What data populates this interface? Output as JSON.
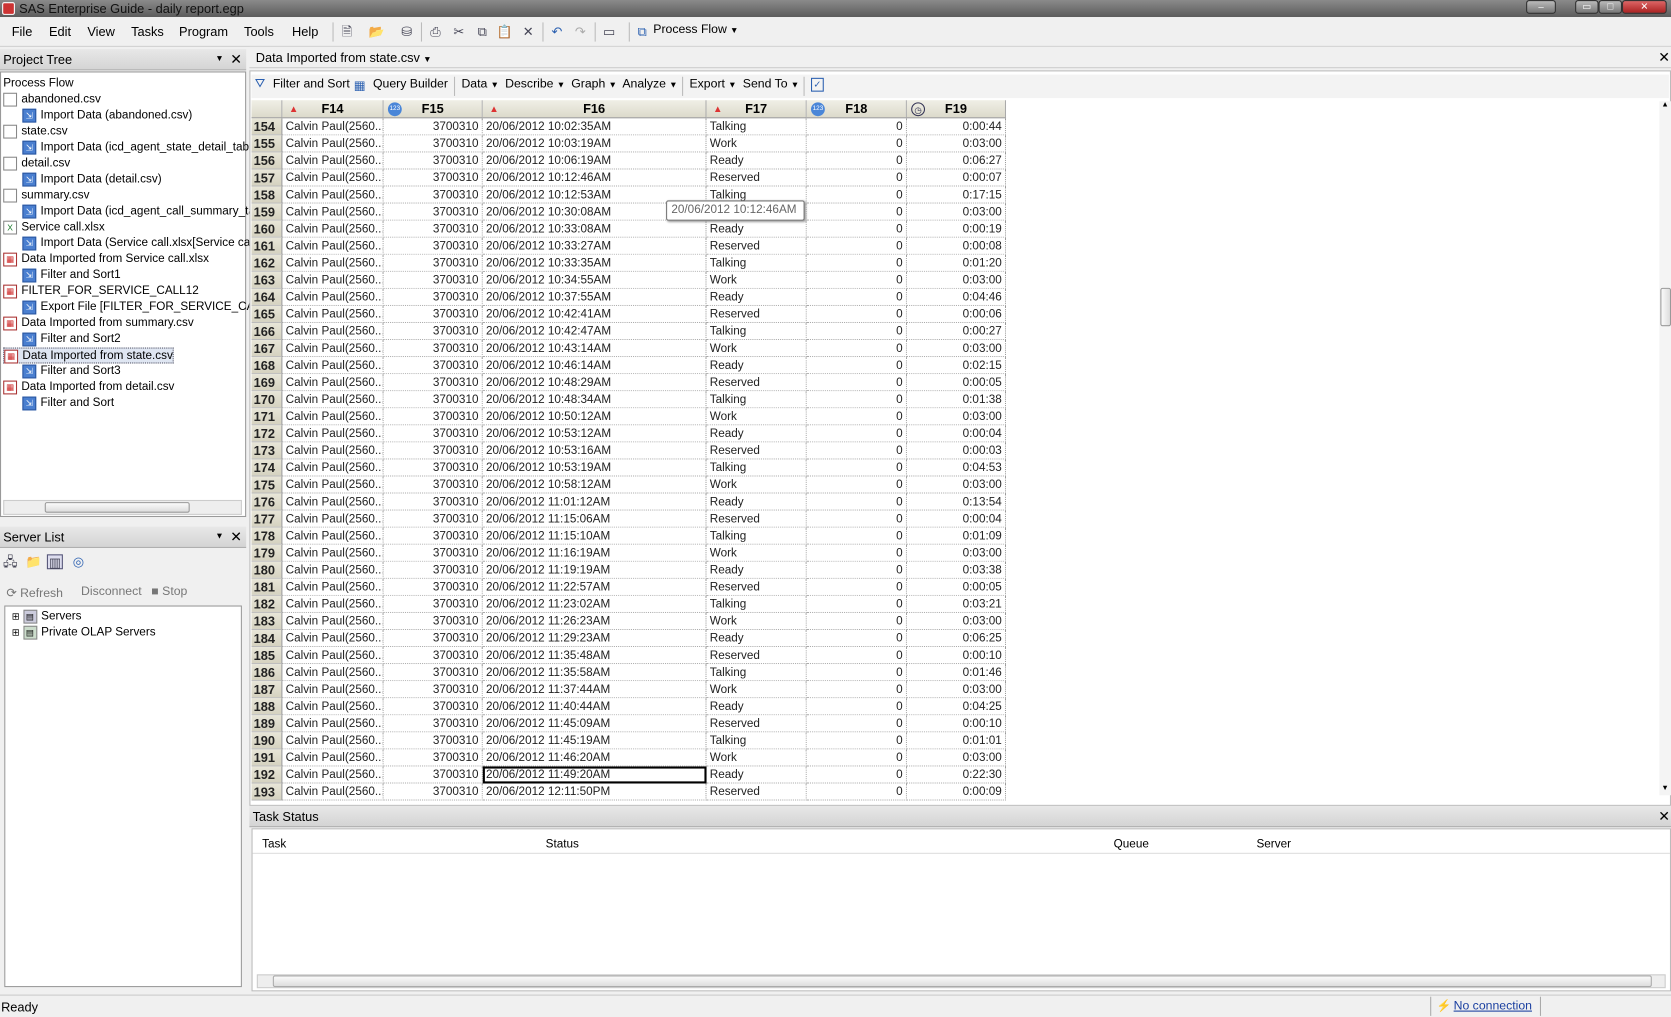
{
  "window": {
    "title": "SAS Enterprise Guide - daily report.egp"
  },
  "menu": [
    "File",
    "Edit",
    "View",
    "Tasks",
    "Program",
    "Tools",
    "Help"
  ],
  "toolbar": {
    "process_flow": "Process Flow"
  },
  "project_tree": {
    "title": "Project Tree",
    "root": "Process Flow",
    "items": [
      {
        "label": "abandoned.csv",
        "level": 0,
        "type": "file"
      },
      {
        "label": "Import Data (abandoned.csv)",
        "level": 1,
        "type": "task"
      },
      {
        "label": "state.csv",
        "level": 0,
        "type": "file"
      },
      {
        "label": "Import Data (icd_agent_state_detail_table_",
        "level": 1,
        "type": "task"
      },
      {
        "label": "detail.csv",
        "level": 0,
        "type": "file"
      },
      {
        "label": "Import Data (detail.csv)",
        "level": 1,
        "type": "task"
      },
      {
        "label": "summary.csv",
        "level": 0,
        "type": "file"
      },
      {
        "label": "Import Data (icd_agent_call_summary_table",
        "level": 1,
        "type": "task"
      },
      {
        "label": "Service call.xlsx",
        "level": 0,
        "type": "xls"
      },
      {
        "label": "Import Data (Service call.xlsx[Service call])",
        "level": 1,
        "type": "task"
      },
      {
        "label": "Data Imported from Service call.xlsx",
        "level": 0,
        "type": "data"
      },
      {
        "label": "Filter and Sort1",
        "level": 1,
        "type": "task"
      },
      {
        "label": "FILTER_FOR_SERVICE_CALL12",
        "level": 0,
        "type": "data"
      },
      {
        "label": "Export File [FILTER_FOR_SERVICE_CALL",
        "level": 1,
        "type": "task"
      },
      {
        "label": "Data Imported from summary.csv",
        "level": 0,
        "type": "data"
      },
      {
        "label": "Filter and Sort2",
        "level": 1,
        "type": "task"
      },
      {
        "label": "Data Imported from state.csv",
        "level": 0,
        "type": "data",
        "selected": true
      },
      {
        "label": "Filter and Sort3",
        "level": 1,
        "type": "task"
      },
      {
        "label": "Data Imported from detail.csv",
        "level": 0,
        "type": "data"
      },
      {
        "label": "Filter and Sort",
        "level": 1,
        "type": "task"
      }
    ]
  },
  "server_list": {
    "title": "Server List",
    "refresh": "Refresh",
    "disconnect": "Disconnect",
    "stop": "Stop",
    "items": [
      "Servers",
      "Private OLAP Servers"
    ]
  },
  "data_tab": {
    "title": "Data Imported from state.csv",
    "toolbar": {
      "filter_sort": "Filter and Sort",
      "query_builder": "Query Builder",
      "data": "Data",
      "describe": "Describe",
      "graph": "Graph",
      "analyze": "Analyze",
      "export": "Export",
      "send_to": "Send To"
    },
    "columns": [
      {
        "name": "F14",
        "type": "char"
      },
      {
        "name": "F15",
        "type": "num"
      },
      {
        "name": "F16",
        "type": "char"
      },
      {
        "name": "F17",
        "type": "char"
      },
      {
        "name": "F18",
        "type": "num"
      },
      {
        "name": "F19",
        "type": "time"
      }
    ],
    "tooltip": "20/06/2012  10:12:46AM",
    "selected_row": "192",
    "rows": [
      [
        "154",
        "Calvin Paul(2560...",
        "3700310",
        "20/06/2012  10:02:35AM",
        "Talking",
        "0",
        "0:00:44"
      ],
      [
        "155",
        "Calvin Paul(2560...",
        "3700310",
        "20/06/2012  10:03:19AM",
        "Work",
        "0",
        "0:03:00"
      ],
      [
        "156",
        "Calvin Paul(2560...",
        "3700310",
        "20/06/2012  10:06:19AM",
        "Ready",
        "0",
        "0:06:27"
      ],
      [
        "157",
        "Calvin Paul(2560...",
        "3700310",
        "20/06/2012  10:12:46AM",
        "Reserved",
        "0",
        "0:00:07"
      ],
      [
        "158",
        "Calvin Paul(2560...",
        "3700310",
        "20/06/2012  10:12:53AM",
        "Talking",
        "0",
        "0:17:15"
      ],
      [
        "159",
        "Calvin Paul(2560...",
        "3700310",
        "20/06/2012  10:30:08AM",
        "",
        "0",
        "0:03:00"
      ],
      [
        "160",
        "Calvin Paul(2560...",
        "3700310",
        "20/06/2012  10:33:08AM",
        "Ready",
        "0",
        "0:00:19"
      ],
      [
        "161",
        "Calvin Paul(2560...",
        "3700310",
        "20/06/2012  10:33:27AM",
        "Reserved",
        "0",
        "0:00:08"
      ],
      [
        "162",
        "Calvin Paul(2560...",
        "3700310",
        "20/06/2012  10:33:35AM",
        "Talking",
        "0",
        "0:01:20"
      ],
      [
        "163",
        "Calvin Paul(2560...",
        "3700310",
        "20/06/2012  10:34:55AM",
        "Work",
        "0",
        "0:03:00"
      ],
      [
        "164",
        "Calvin Paul(2560...",
        "3700310",
        "20/06/2012  10:37:55AM",
        "Ready",
        "0",
        "0:04:46"
      ],
      [
        "165",
        "Calvin Paul(2560...",
        "3700310",
        "20/06/2012  10:42:41AM",
        "Reserved",
        "0",
        "0:00:06"
      ],
      [
        "166",
        "Calvin Paul(2560...",
        "3700310",
        "20/06/2012  10:42:47AM",
        "Talking",
        "0",
        "0:00:27"
      ],
      [
        "167",
        "Calvin Paul(2560...",
        "3700310",
        "20/06/2012  10:43:14AM",
        "Work",
        "0",
        "0:03:00"
      ],
      [
        "168",
        "Calvin Paul(2560...",
        "3700310",
        "20/06/2012  10:46:14AM",
        "Ready",
        "0",
        "0:02:15"
      ],
      [
        "169",
        "Calvin Paul(2560...",
        "3700310",
        "20/06/2012  10:48:29AM",
        "Reserved",
        "0",
        "0:00:05"
      ],
      [
        "170",
        "Calvin Paul(2560...",
        "3700310",
        "20/06/2012  10:48:34AM",
        "Talking",
        "0",
        "0:01:38"
      ],
      [
        "171",
        "Calvin Paul(2560...",
        "3700310",
        "20/06/2012  10:50:12AM",
        "Work",
        "0",
        "0:03:00"
      ],
      [
        "172",
        "Calvin Paul(2560...",
        "3700310",
        "20/06/2012  10:53:12AM",
        "Ready",
        "0",
        "0:00:04"
      ],
      [
        "173",
        "Calvin Paul(2560...",
        "3700310",
        "20/06/2012  10:53:16AM",
        "Reserved",
        "0",
        "0:00:03"
      ],
      [
        "174",
        "Calvin Paul(2560...",
        "3700310",
        "20/06/2012  10:53:19AM",
        "Talking",
        "0",
        "0:04:53"
      ],
      [
        "175",
        "Calvin Paul(2560...",
        "3700310",
        "20/06/2012  10:58:12AM",
        "Work",
        "0",
        "0:03:00"
      ],
      [
        "176",
        "Calvin Paul(2560...",
        "3700310",
        "20/06/2012  11:01:12AM",
        "Ready",
        "0",
        "0:13:54"
      ],
      [
        "177",
        "Calvin Paul(2560...",
        "3700310",
        "20/06/2012  11:15:06AM",
        "Reserved",
        "0",
        "0:00:04"
      ],
      [
        "178",
        "Calvin Paul(2560...",
        "3700310",
        "20/06/2012  11:15:10AM",
        "Talking",
        "0",
        "0:01:09"
      ],
      [
        "179",
        "Calvin Paul(2560...",
        "3700310",
        "20/06/2012  11:16:19AM",
        "Work",
        "0",
        "0:03:00"
      ],
      [
        "180",
        "Calvin Paul(2560...",
        "3700310",
        "20/06/2012  11:19:19AM",
        "Ready",
        "0",
        "0:03:38"
      ],
      [
        "181",
        "Calvin Paul(2560...",
        "3700310",
        "20/06/2012  11:22:57AM",
        "Reserved",
        "0",
        "0:00:05"
      ],
      [
        "182",
        "Calvin Paul(2560...",
        "3700310",
        "20/06/2012  11:23:02AM",
        "Talking",
        "0",
        "0:03:21"
      ],
      [
        "183",
        "Calvin Paul(2560...",
        "3700310",
        "20/06/2012  11:26:23AM",
        "Work",
        "0",
        "0:03:00"
      ],
      [
        "184",
        "Calvin Paul(2560...",
        "3700310",
        "20/06/2012  11:29:23AM",
        "Ready",
        "0",
        "0:06:25"
      ],
      [
        "185",
        "Calvin Paul(2560...",
        "3700310",
        "20/06/2012  11:35:48AM",
        "Reserved",
        "0",
        "0:00:10"
      ],
      [
        "186",
        "Calvin Paul(2560...",
        "3700310",
        "20/06/2012  11:35:58AM",
        "Talking",
        "0",
        "0:01:46"
      ],
      [
        "187",
        "Calvin Paul(2560...",
        "3700310",
        "20/06/2012  11:37:44AM",
        "Work",
        "0",
        "0:03:00"
      ],
      [
        "188",
        "Calvin Paul(2560...",
        "3700310",
        "20/06/2012  11:40:44AM",
        "Ready",
        "0",
        "0:04:25"
      ],
      [
        "189",
        "Calvin Paul(2560...",
        "3700310",
        "20/06/2012  11:45:09AM",
        "Reserved",
        "0",
        "0:00:10"
      ],
      [
        "190",
        "Calvin Paul(2560...",
        "3700310",
        "20/06/2012  11:45:19AM",
        "Talking",
        "0",
        "0:01:01"
      ],
      [
        "191",
        "Calvin Paul(2560...",
        "3700310",
        "20/06/2012  11:46:20AM",
        "Work",
        "0",
        "0:03:00"
      ],
      [
        "192",
        "Calvin Paul(2560...",
        "3700310",
        "20/06/2012  11:49:20AM",
        "Ready",
        "0",
        "0:22:30"
      ],
      [
        "193",
        "Calvin Paul(2560...",
        "3700310",
        "20/06/2012  12:11:50PM",
        "Reserved",
        "0",
        "0:00:09"
      ]
    ]
  },
  "task_status": {
    "title": "Task Status",
    "columns": [
      "Task",
      "Status",
      "Queue",
      "Server"
    ]
  },
  "statusbar": {
    "text": "Ready",
    "connection": "No connection"
  }
}
